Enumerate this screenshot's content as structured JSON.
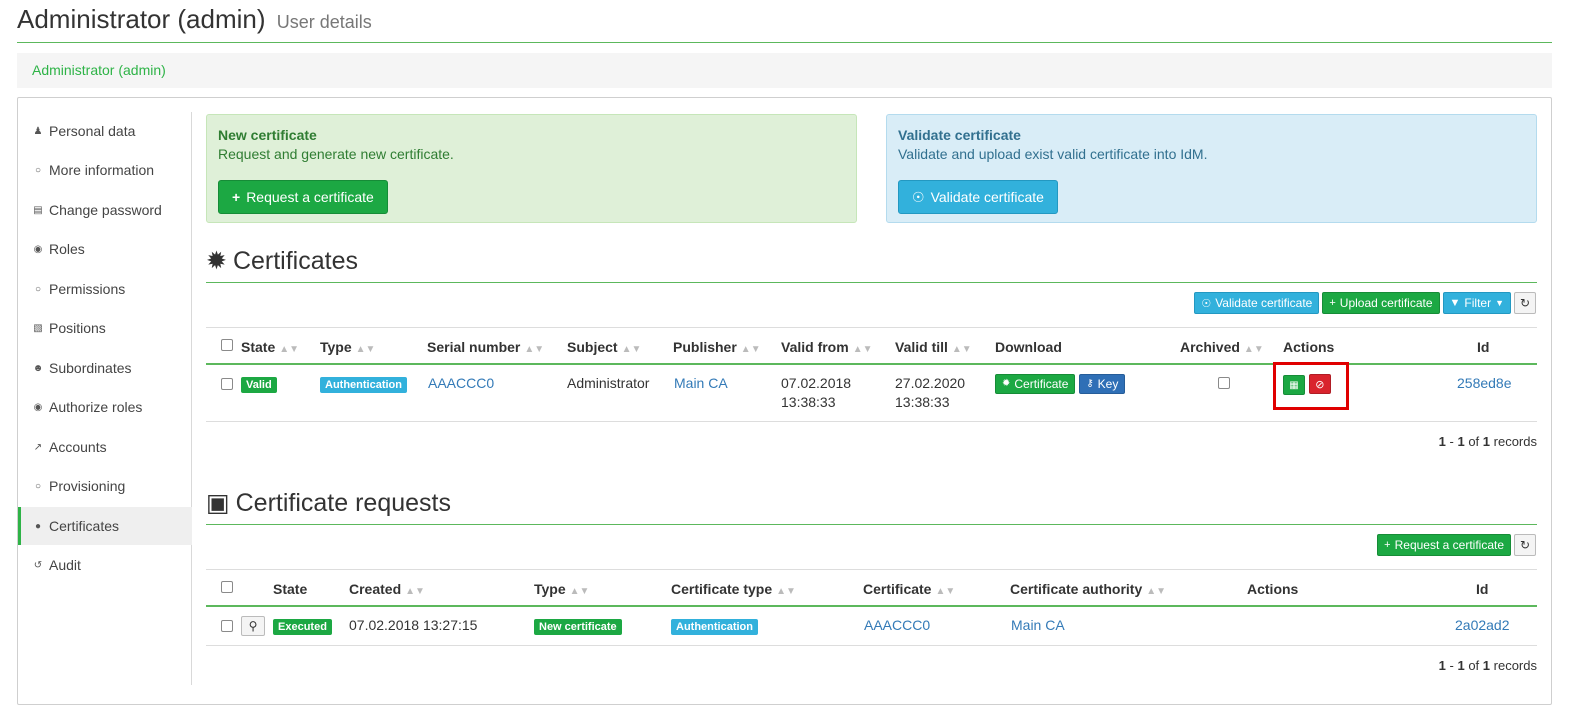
{
  "header": {
    "title": "Administrator (admin)",
    "subtitle": "User details"
  },
  "breadcrumb": {
    "label": "Administrator (admin)"
  },
  "sidebar": {
    "items": [
      {
        "label": "Personal data",
        "icon": "user-icon"
      },
      {
        "label": "More information",
        "icon": "circle-icon"
      },
      {
        "label": "Change password",
        "icon": "lock-icon"
      },
      {
        "label": "Roles",
        "icon": "roles-icon"
      },
      {
        "label": "Permissions",
        "icon": "circle-icon"
      },
      {
        "label": "Positions",
        "icon": "building-icon"
      },
      {
        "label": "Subordinates",
        "icon": "users-icon"
      },
      {
        "label": "Authorize roles",
        "icon": "roles-icon"
      },
      {
        "label": "Accounts",
        "icon": "external-link-icon"
      },
      {
        "label": "Provisioning",
        "icon": "circle-icon"
      },
      {
        "label": "Certificates",
        "icon": "dot-icon",
        "active": true
      },
      {
        "label": "Audit",
        "icon": "history-icon"
      }
    ]
  },
  "new_certificate": {
    "title": "New certificate",
    "text": "Request and generate new certificate.",
    "button": "Request a certificate"
  },
  "validate_certificate": {
    "title": "Validate certificate",
    "text": "Validate and upload exist valid certificate into IdM.",
    "button": "Validate certificate"
  },
  "certificates": {
    "title": "Certificates",
    "toolbar": {
      "validate": "Validate certificate",
      "upload": "Upload certificate",
      "filter": "Filter"
    },
    "columns": {
      "state": "State",
      "type": "Type",
      "serial": "Serial number",
      "subject": "Subject",
      "publisher": "Publisher",
      "valid_from": "Valid from",
      "valid_till": "Valid till",
      "download": "Download",
      "archived": "Archived",
      "actions": "Actions",
      "id": "Id"
    },
    "rows": [
      {
        "state": "Valid",
        "type": "Authentication",
        "serial": "AAACCC0",
        "subject": "Administrator",
        "publisher": "Main CA",
        "valid_from_date": "07.02.2018",
        "valid_from_time": "13:38:33",
        "valid_till_date": "27.02.2020",
        "valid_till_time": "13:38:33",
        "download_certificate": "Certificate",
        "download_key": "Key",
        "id": "258ed8e"
      }
    ],
    "pager": {
      "from": "1",
      "to": "1",
      "of_label": "of",
      "total": "1",
      "records_label": "records",
      "sep": "-"
    }
  },
  "requests": {
    "title": "Certificate requests",
    "toolbar": {
      "request": "Request a certificate"
    },
    "columns": {
      "state": "State",
      "created": "Created",
      "type": "Type",
      "cert_type": "Certificate type",
      "certificate": "Certificate",
      "authority": "Certificate authority",
      "actions": "Actions",
      "id": "Id"
    },
    "rows": [
      {
        "state": "Executed",
        "created": "07.02.2018 13:27:15",
        "type": "New certificate",
        "cert_type": "Authentication",
        "certificate": "AAACCC0",
        "authority": "Main CA",
        "id": "2a02ad2"
      }
    ],
    "pager": {
      "from": "1",
      "to": "1",
      "of_label": "of",
      "total": "1",
      "records_label": "records",
      "sep": "-"
    }
  },
  "colors": {
    "success": "#1ca843",
    "info": "#32b1dc",
    "danger": "#d9232d",
    "primary": "#2f6fb6",
    "accent_line": "#5cb85c",
    "highlight": "#e00000"
  }
}
